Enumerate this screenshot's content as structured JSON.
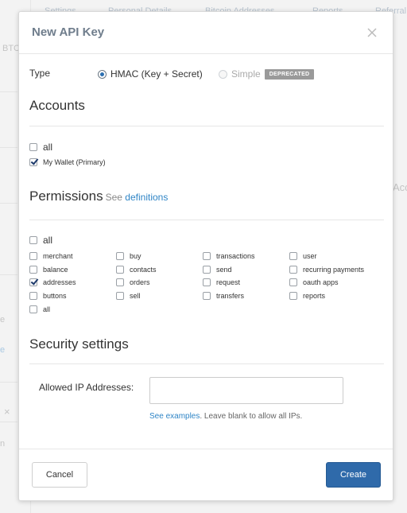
{
  "background": {
    "tabs": [
      "Settings",
      "Personal Details",
      "Bitcoin Addresses",
      "Reports",
      "Referral"
    ],
    "fragments": [
      "BTC",
      "Acco",
      "e",
      "e",
      "×",
      "n"
    ]
  },
  "modal": {
    "title": "New API Key",
    "type": {
      "label": "Type",
      "options": [
        {
          "label": "HMAC (Key + Secret)",
          "selected": true
        },
        {
          "label": "Simple",
          "selected": false,
          "disabled": true,
          "badge": "DEPRECATED"
        }
      ]
    },
    "accounts": {
      "title": "Accounts",
      "all_label": "all",
      "items": [
        {
          "label": "My Wallet (Primary)",
          "checked": true
        }
      ]
    },
    "permissions": {
      "title": "Permissions",
      "see_text": "See",
      "definitions_link": "definitions",
      "all_label": "all",
      "columns": [
        [
          {
            "label": "merchant",
            "checked": false
          },
          {
            "label": "balance",
            "checked": false
          },
          {
            "label": "addresses",
            "checked": true
          },
          {
            "label": "buttons",
            "checked": false
          },
          {
            "label": "all",
            "checked": false
          }
        ],
        [
          {
            "label": "buy",
            "checked": false
          },
          {
            "label": "contacts",
            "checked": false
          },
          {
            "label": "orders",
            "checked": false
          },
          {
            "label": "sell",
            "checked": false
          }
        ],
        [
          {
            "label": "transactions",
            "checked": false
          },
          {
            "label": "send",
            "checked": false
          },
          {
            "label": "request",
            "checked": false
          },
          {
            "label": "transfers",
            "checked": false
          }
        ],
        [
          {
            "label": "user",
            "checked": false
          },
          {
            "label": "recurring payments",
            "checked": false
          },
          {
            "label": "oauth apps",
            "checked": false
          },
          {
            "label": "reports",
            "checked": false
          }
        ]
      ]
    },
    "security": {
      "title": "Security settings",
      "ip_label": "Allowed IP Addresses:",
      "ip_value": "",
      "help_link": "See examples",
      "help_text": ". Leave blank to allow all IPs."
    },
    "footer": {
      "cancel_label": "Cancel",
      "create_label": "Create"
    }
  },
  "colors": {
    "accent": "#2f6aaa",
    "link": "#2f85c6",
    "title": "#6f7d8c",
    "badge": "#9a9a9a"
  }
}
